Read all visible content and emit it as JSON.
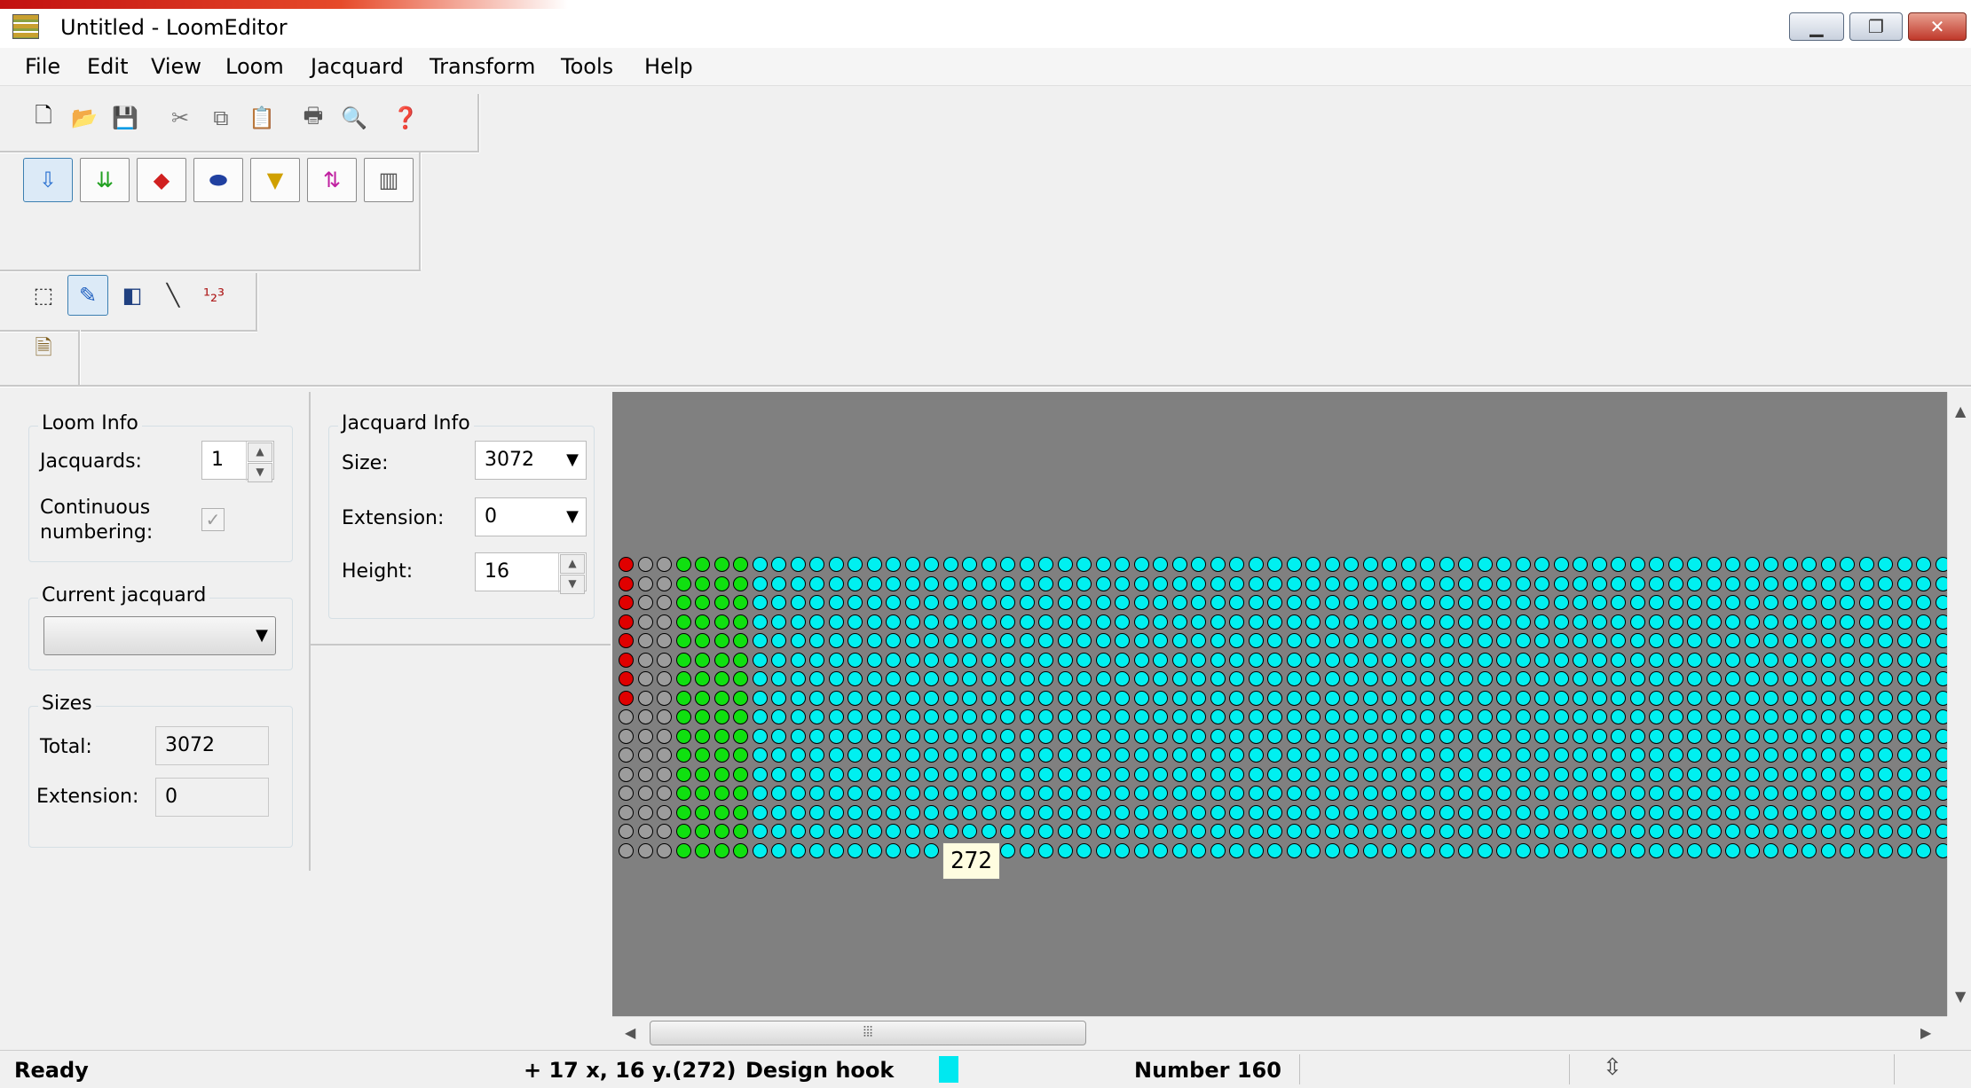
{
  "window": {
    "title": "Untitled - LoomEditor"
  },
  "menu": [
    "File",
    "Edit",
    "View",
    "Loom",
    "Jacquard",
    "Transform",
    "Tools",
    "Help"
  ],
  "toolbar_std": [
    "new-icon",
    "open-icon",
    "save-icon",
    "cut-icon",
    "copy-icon",
    "paste-icon",
    "print-icon",
    "print-preview-icon",
    "help-icon"
  ],
  "toolbar_loom": [
    "select-hooks-icon",
    "green-hooks-icon",
    "red-hooks-icon",
    "color-fill-icon",
    "yellow-hooks-icon",
    "swap-icon",
    "loom-icon"
  ],
  "toolbar_tools": [
    "rect-select-icon",
    "pen-icon",
    "rectangle-icon",
    "line-icon",
    "numbering-icon"
  ],
  "toolbar_tools_active": "pen-icon",
  "toolbar_extra": [
    "properties-icon"
  ],
  "loom_info": {
    "title": "Loom Info",
    "jacquards_label": "Jacquards:",
    "jacquards_value": "1",
    "continuous_label_1": "Continuous",
    "continuous_label_2": "numbering:",
    "continuous_checked": true
  },
  "current_jacquard": {
    "title": "Current jacquard",
    "value": ""
  },
  "sizes": {
    "title": "Sizes",
    "total_label": "Total:",
    "total_value": "3072",
    "extension_label": "Extension:",
    "extension_value": "0"
  },
  "jacquard_info": {
    "title": "Jacquard Info",
    "size_label": "Size:",
    "size_value": "3072",
    "extension_label": "Extension:",
    "extension_value": "0",
    "height_label": "Height:",
    "height_value": "16"
  },
  "hook_grid": {
    "rows": 16,
    "cols": 70,
    "red_rows": 8,
    "colors": {
      "red": "#e00000",
      "grey": "#9c9c9c",
      "green": "#10e010",
      "cyan": "#00f0f0",
      "background": "#808080"
    },
    "tooltip": "272"
  },
  "status": {
    "ready": "Ready",
    "coords": "+ 17 x, 16 y.(272)",
    "mode": "Design hook",
    "mode_color": "#00e8f0",
    "number": "Number  160"
  }
}
